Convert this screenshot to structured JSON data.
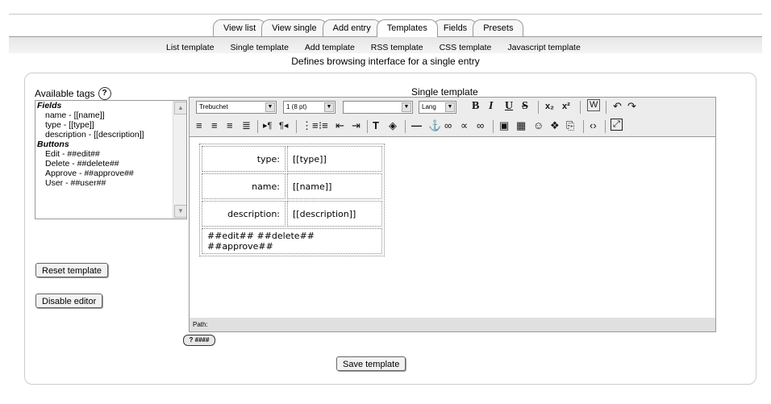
{
  "tabs": [
    "View list",
    "View single",
    "Add entry",
    "Templates",
    "Fields",
    "Presets"
  ],
  "active_tab": "Templates",
  "subtabs": [
    "List template",
    "Single template",
    "Add template",
    "RSS template",
    "CSS template",
    "Javascript template"
  ],
  "description": "Defines browsing interface for a single entry",
  "available_tags": {
    "label": "Available tags",
    "help_icon": "?",
    "fields_heading": "Fields",
    "fields": [
      "name - [[name]]",
      "type - [[type]]",
      "description - [[description]]"
    ],
    "buttons_heading": "Buttons",
    "buttons": [
      "Edit - ##edit##",
      "Delete - ##delete##",
      "Approve - ##approve##",
      "User - ##user##"
    ]
  },
  "reset_button": "Reset template",
  "disable_button": "Disable editor",
  "editor": {
    "title": "Single template",
    "font_select": "Trebuchet",
    "size_select": "1 (8 pt)",
    "style_select": "",
    "lang_select": "Lang",
    "path_label": "Path:",
    "rows": [
      {
        "label": "type:",
        "value": "[[type]]"
      },
      {
        "label": "name:",
        "value": "[[name]]"
      },
      {
        "label": "description:",
        "value": "[[description]]"
      }
    ],
    "buttons_row": "##edit## ##delete## ##approve##"
  },
  "keyboard_help": "? ####",
  "save_button": "Save template",
  "icons": [
    "bold-icon",
    "italic-icon",
    "underline-icon",
    "strikethrough-icon",
    "subscript-icon",
    "superscript-icon",
    "clean-word-icon",
    "undo-icon",
    "redo-icon",
    "justify-left-icon",
    "justify-center-icon",
    "justify-right-icon",
    "justify-full-icon",
    "ltr-icon",
    "rtl-icon",
    "ordered-list-icon",
    "unordered-list-icon",
    "outdent-icon",
    "indent-icon",
    "text-color-icon",
    "bg-color-icon",
    "horizontal-rule-icon",
    "anchor-icon",
    "link-icon",
    "unlink-icon",
    "nolink-icon",
    "image-icon",
    "table-icon",
    "smiley-icon",
    "special-char-icon",
    "search-replace-icon",
    "html-source-icon",
    "fullscreen-icon"
  ]
}
